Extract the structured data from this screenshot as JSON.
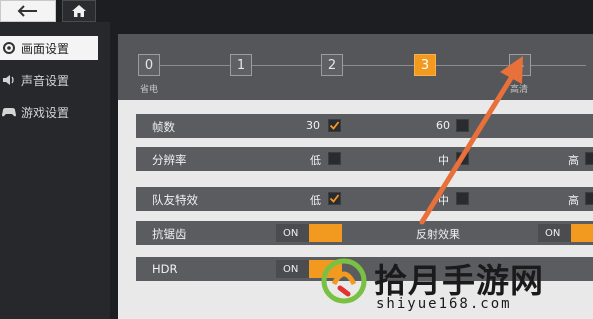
{
  "sidebar": {
    "items": [
      {
        "label": "画面设置",
        "icon": "display-icon",
        "active": true
      },
      {
        "label": "声音设置",
        "icon": "speaker-icon",
        "active": false
      },
      {
        "label": "游戏设置",
        "icon": "gamepad-icon",
        "active": false
      }
    ]
  },
  "quality": {
    "levels": [
      "0",
      "1",
      "2",
      "3",
      "4"
    ],
    "selected": "3",
    "left_caption": "省电",
    "right_caption": "高清"
  },
  "settings": {
    "fps": {
      "label": "帧数",
      "opt1": "30",
      "opt2": "60"
    },
    "resolution": {
      "label": "分辨率",
      "opt1": "低",
      "opt2": "中",
      "opt3": "高"
    },
    "teammate_effects": {
      "label": "队友特效",
      "opt1": "低",
      "opt2": "中",
      "opt3": "高"
    },
    "antialias": {
      "label": "抗锯齿",
      "toggle": "ON"
    },
    "reflection": {
      "label": "反射效果",
      "toggle": "ON"
    },
    "hdr": {
      "label": "HDR",
      "toggle": "ON"
    }
  },
  "watermark": {
    "title": "拾月手游网",
    "url": "shiyue168.com"
  },
  "colors": {
    "accent": "#f29a20",
    "arrow": "#e8703a",
    "panel_bg": "#e9e9e9",
    "row_bg": "#5a5c60"
  }
}
